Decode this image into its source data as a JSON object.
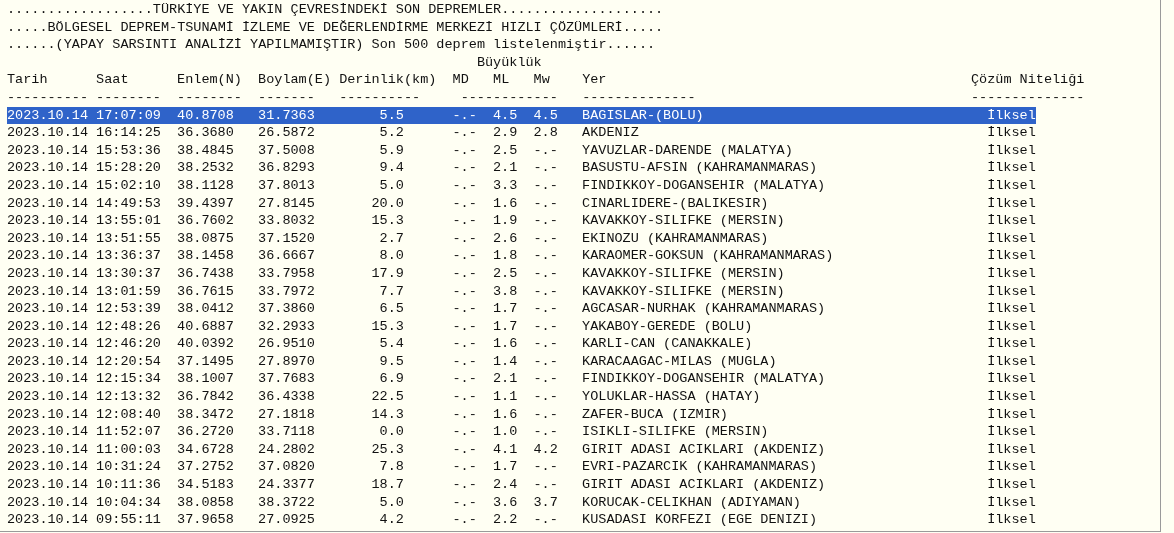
{
  "title_lines": [
    "..................TÜRKİYE VE YAKIN ÇEVRESİNDEKİ SON DEPREMLER....................",
    ".....BÖLGESEL DEPREM-TSUNAMİ İZLEME VE DEĞERLENDİRME MERKEZİ HIZLI ÇÖZÜMLERİ.....",
    "......(YAPAY SARSINTI ANALİZİ YAPILMAMIŞTIR) Son 500 deprem listelenmiştir......"
  ],
  "magnitude_group_label": "Büyüklük",
  "columns": [
    {
      "label": "Tarih",
      "rule": "----------"
    },
    {
      "label": "Saat",
      "rule": "--------"
    },
    {
      "label": "Enlem(N)",
      "rule": "--------"
    },
    {
      "label": "Boylam(E)",
      "rule": "-------"
    },
    {
      "label": "Derinlik(km)",
      "rule": "----------"
    },
    {
      "label": "MD",
      "rule": "------------"
    },
    {
      "label": "ML"
    },
    {
      "label": "Mw"
    },
    {
      "label": "Yer",
      "rule": "--------------"
    },
    {
      "label": "Çözüm Niteliği",
      "rule": "--------------"
    }
  ],
  "rows": [
    {
      "date": "2023.10.14",
      "time": "17:07:09",
      "latitude": "40.8708",
      "longitude": "31.7363",
      "depth_km": "5.5",
      "md": "-.-",
      "ml": "4.5",
      "mw": "4.5",
      "location": "BAGISLAR-(BOLU)",
      "quality": "İlksel",
      "selected": true
    },
    {
      "date": "2023.10.14",
      "time": "16:14:25",
      "latitude": "36.3680",
      "longitude": "26.5872",
      "depth_km": "5.2",
      "md": "-.-",
      "ml": "2.9",
      "mw": "2.8",
      "location": "AKDENIZ",
      "quality": "İlksel",
      "selected": false
    },
    {
      "date": "2023.10.14",
      "time": "15:53:36",
      "latitude": "38.4845",
      "longitude": "37.5008",
      "depth_km": "5.9",
      "md": "-.-",
      "ml": "2.5",
      "mw": "-.-",
      "location": "YAVUZLAR-DARENDE (MALATYA)",
      "quality": "İlksel",
      "selected": false
    },
    {
      "date": "2023.10.14",
      "time": "15:28:20",
      "latitude": "38.2532",
      "longitude": "36.8293",
      "depth_km": "9.4",
      "md": "-.-",
      "ml": "2.1",
      "mw": "-.-",
      "location": "BASUSTU-AFSIN (KAHRAMANMARAS)",
      "quality": "İlksel",
      "selected": false
    },
    {
      "date": "2023.10.14",
      "time": "15:02:10",
      "latitude": "38.1128",
      "longitude": "37.8013",
      "depth_km": "5.0",
      "md": "-.-",
      "ml": "3.3",
      "mw": "-.-",
      "location": "FINDIKKOY-DOGANSEHIR (MALATYA)",
      "quality": "İlksel",
      "selected": false
    },
    {
      "date": "2023.10.14",
      "time": "14:49:53",
      "latitude": "39.4397",
      "longitude": "27.8145",
      "depth_km": "20.0",
      "md": "-.-",
      "ml": "1.6",
      "mw": "-.-",
      "location": "CINARLIDERE-(BALIKESIR)",
      "quality": "İlksel",
      "selected": false
    },
    {
      "date": "2023.10.14",
      "time": "13:55:01",
      "latitude": "36.7602",
      "longitude": "33.8032",
      "depth_km": "15.3",
      "md": "-.-",
      "ml": "1.9",
      "mw": "-.-",
      "location": "KAVAKKOY-SILIFKE (MERSIN)",
      "quality": "İlksel",
      "selected": false
    },
    {
      "date": "2023.10.14",
      "time": "13:51:55",
      "latitude": "38.0875",
      "longitude": "37.1520",
      "depth_km": "2.7",
      "md": "-.-",
      "ml": "2.6",
      "mw": "-.-",
      "location": "EKINOZU (KAHRAMANMARAS)",
      "quality": "İlksel",
      "selected": false
    },
    {
      "date": "2023.10.14",
      "time": "13:36:37",
      "latitude": "38.1458",
      "longitude": "36.6667",
      "depth_km": "8.0",
      "md": "-.-",
      "ml": "1.8",
      "mw": "-.-",
      "location": "KARAOMER-GOKSUN (KAHRAMANMARAS)",
      "quality": "İlksel",
      "selected": false
    },
    {
      "date": "2023.10.14",
      "time": "13:30:37",
      "latitude": "36.7438",
      "longitude": "33.7958",
      "depth_km": "17.9",
      "md": "-.-",
      "ml": "2.5",
      "mw": "-.-",
      "location": "KAVAKKOY-SILIFKE (MERSIN)",
      "quality": "İlksel",
      "selected": false
    },
    {
      "date": "2023.10.14",
      "time": "13:01:59",
      "latitude": "36.7615",
      "longitude": "33.7972",
      "depth_km": "7.7",
      "md": "-.-",
      "ml": "3.8",
      "mw": "-.-",
      "location": "KAVAKKOY-SILIFKE (MERSIN)",
      "quality": "İlksel",
      "selected": false
    },
    {
      "date": "2023.10.14",
      "time": "12:53:39",
      "latitude": "38.0412",
      "longitude": "37.3860",
      "depth_km": "6.5",
      "md": "-.-",
      "ml": "1.7",
      "mw": "-.-",
      "location": "AGCASAR-NURHAK (KAHRAMANMARAS)",
      "quality": "İlksel",
      "selected": false
    },
    {
      "date": "2023.10.14",
      "time": "12:48:26",
      "latitude": "40.6887",
      "longitude": "32.2933",
      "depth_km": "15.3",
      "md": "-.-",
      "ml": "1.7",
      "mw": "-.-",
      "location": "YAKABOY-GEREDE (BOLU)",
      "quality": "İlksel",
      "selected": false
    },
    {
      "date": "2023.10.14",
      "time": "12:46:20",
      "latitude": "40.0392",
      "longitude": "26.9510",
      "depth_km": "5.4",
      "md": "-.-",
      "ml": "1.6",
      "mw": "-.-",
      "location": "KARLI-CAN (CANAKKALE)",
      "quality": "İlksel",
      "selected": false
    },
    {
      "date": "2023.10.14",
      "time": "12:20:54",
      "latitude": "37.1495",
      "longitude": "27.8970",
      "depth_km": "9.5",
      "md": "-.-",
      "ml": "1.4",
      "mw": "-.-",
      "location": "KARACAAGAC-MILAS (MUGLA)",
      "quality": "İlksel",
      "selected": false
    },
    {
      "date": "2023.10.14",
      "time": "12:15:34",
      "latitude": "38.1007",
      "longitude": "37.7683",
      "depth_km": "6.9",
      "md": "-.-",
      "ml": "2.1",
      "mw": "-.-",
      "location": "FINDIKKOY-DOGANSEHIR (MALATYA)",
      "quality": "İlksel",
      "selected": false
    },
    {
      "date": "2023.10.14",
      "time": "12:13:32",
      "latitude": "36.7842",
      "longitude": "36.4338",
      "depth_km": "22.5",
      "md": "-.-",
      "ml": "1.1",
      "mw": "-.-",
      "location": "YOLUKLAR-HASSA (HATAY)",
      "quality": "İlksel",
      "selected": false
    },
    {
      "date": "2023.10.14",
      "time": "12:08:40",
      "latitude": "38.3472",
      "longitude": "27.1818",
      "depth_km": "14.3",
      "md": "-.-",
      "ml": "1.6",
      "mw": "-.-",
      "location": "ZAFER-BUCA (IZMIR)",
      "quality": "İlksel",
      "selected": false
    },
    {
      "date": "2023.10.14",
      "time": "11:52:07",
      "latitude": "36.2720",
      "longitude": "33.7118",
      "depth_km": "0.0",
      "md": "-.-",
      "ml": "1.0",
      "mw": "-.-",
      "location": "ISIKLI-SILIFKE (MERSIN)",
      "quality": "İlksel",
      "selected": false
    },
    {
      "date": "2023.10.14",
      "time": "11:00:03",
      "latitude": "34.6728",
      "longitude": "24.2802",
      "depth_km": "25.3",
      "md": "-.-",
      "ml": "4.1",
      "mw": "4.2",
      "location": "GIRIT ADASI ACIKLARI (AKDENIZ)",
      "quality": "İlksel",
      "selected": false
    },
    {
      "date": "2023.10.14",
      "time": "10:31:24",
      "latitude": "37.2752",
      "longitude": "37.0820",
      "depth_km": "7.8",
      "md": "-.-",
      "ml": "1.7",
      "mw": "-.-",
      "location": "EVRI-PAZARCIK (KAHRAMANMARAS)",
      "quality": "İlksel",
      "selected": false
    },
    {
      "date": "2023.10.14",
      "time": "10:11:36",
      "latitude": "34.5183",
      "longitude": "24.3377",
      "depth_km": "18.7",
      "md": "-.-",
      "ml": "2.4",
      "mw": "-.-",
      "location": "GIRIT ADASI ACIKLARI (AKDENIZ)",
      "quality": "İlksel",
      "selected": false
    },
    {
      "date": "2023.10.14",
      "time": "10:04:34",
      "latitude": "38.0858",
      "longitude": "38.3722",
      "depth_km": "5.0",
      "md": "-.-",
      "ml": "3.6",
      "mw": "3.7",
      "location": "KORUCAK-CELIKHAN (ADIYAMAN)",
      "quality": "İlksel",
      "selected": false
    },
    {
      "date": "2023.10.14",
      "time": "09:55:11",
      "latitude": "37.9658",
      "longitude": "27.0925",
      "depth_km": "4.2",
      "md": "-.-",
      "ml": "2.2",
      "mw": "-.-",
      "location": "KUSADASI KORFEZI (EGE DENIZI)",
      "quality": "İlksel",
      "selected": false
    }
  ]
}
